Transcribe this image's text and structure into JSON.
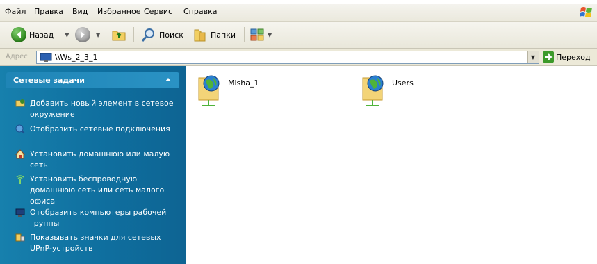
{
  "menu": {
    "items": [
      "Файл",
      "Правка",
      "Вид",
      "Избранное",
      "Сервис",
      "Справка"
    ]
  },
  "toolbar": {
    "back_label": "Назад",
    "search_label": "Поиск",
    "folders_label": "Папки"
  },
  "address": {
    "label": "Адрес",
    "value": "\\\\Ws_2_3_1",
    "go_label": "Переход"
  },
  "taskpane": {
    "title": "Сетевые задачи",
    "tasks": [
      {
        "label": "Добавить новый элемент в сетевое окружение",
        "icon": "add-network-place-icon"
      },
      {
        "label": "Отобразить сетевые подключения",
        "icon": "network-connections-icon"
      },
      {
        "label": "Установить домашнюю или малую сеть",
        "icon": "home-network-icon"
      },
      {
        "label": "Установить беспроводную домашнюю сеть или сеть малого офиса",
        "icon": "wireless-network-icon"
      },
      {
        "label": "Отобразить компьютеры рабочей группы",
        "icon": "workgroup-computers-icon"
      },
      {
        "label": "Показывать значки для сетевых UPnP-устройств",
        "icon": "upnp-devices-icon"
      }
    ]
  },
  "content": {
    "items": [
      {
        "label": "Misha_1",
        "icon": "network-share-folder-icon"
      },
      {
        "label": "Users",
        "icon": "network-share-folder-icon"
      }
    ]
  },
  "colors": {
    "taskpane_bg": "#1077a6",
    "window_chrome": "#ece9d8",
    "back_button_green": "#3c9a2a"
  }
}
